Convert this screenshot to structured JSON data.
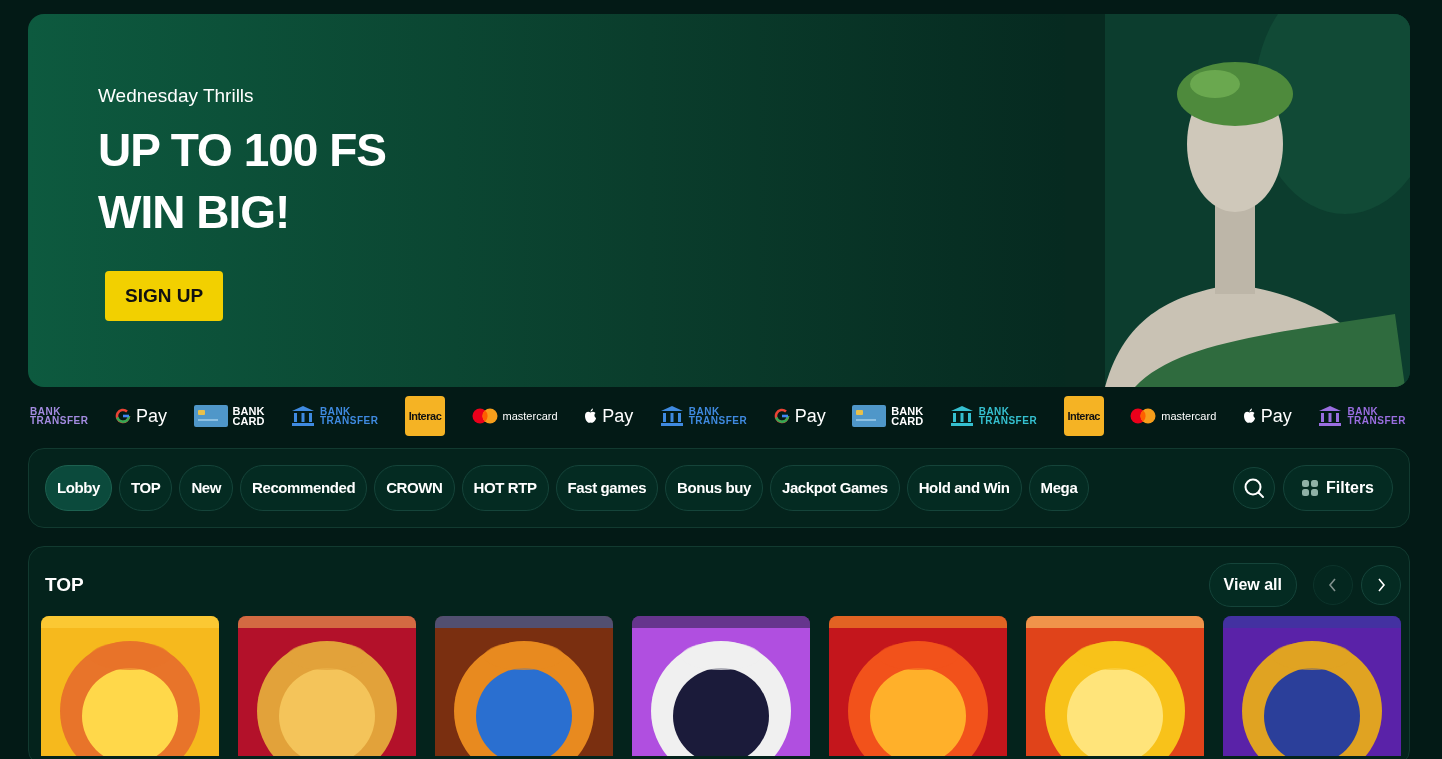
{
  "hero": {
    "kicker": "Wednesday Thrills",
    "headline": [
      "UP TO 100 FS",
      "WIN BIG!"
    ],
    "button": "SIGN UP"
  },
  "payments": [
    {
      "kind": "bank-transfer-text",
      "color": "#a38be0",
      "label": [
        "BANK",
        "TRANSFER"
      ]
    },
    {
      "kind": "gpay",
      "label": [
        "Pay"
      ]
    },
    {
      "kind": "bank-card",
      "label": [
        "BANK",
        "CARD"
      ]
    },
    {
      "kind": "bank-transfer",
      "color": "#3f8ae0",
      "label": [
        "BANK",
        "TRANSFER"
      ]
    },
    {
      "kind": "interac",
      "label": [
        "Interac"
      ]
    },
    {
      "kind": "mastercard",
      "label": [
        "mastercard"
      ]
    },
    {
      "kind": "applepay",
      "label": [
        "Pay"
      ]
    },
    {
      "kind": "bank-transfer",
      "color": "#3f8ae0",
      "label": [
        "BANK",
        "TRANSFER"
      ]
    },
    {
      "kind": "gpay",
      "label": [
        "Pay"
      ]
    },
    {
      "kind": "bank-card",
      "label": [
        "BANK",
        "CARD"
      ]
    },
    {
      "kind": "bank-transfer",
      "color": "#35c0d0",
      "label": [
        "BANK",
        "TRANSFER"
      ]
    },
    {
      "kind": "interac",
      "label": [
        "Interac"
      ]
    },
    {
      "kind": "mastercard",
      "label": [
        "mastercard"
      ]
    },
    {
      "kind": "applepay",
      "label": [
        "Pay"
      ]
    },
    {
      "kind": "bank-transfer",
      "color": "#9a6ee0",
      "label": [
        "BANK",
        "TRANSFER"
      ]
    }
  ],
  "categories": [
    {
      "label": "Lobby",
      "selected": true
    },
    {
      "label": "TOP",
      "selected": false
    },
    {
      "label": "New",
      "selected": false
    },
    {
      "label": "Recommended",
      "selected": false
    },
    {
      "label": "CROWN",
      "selected": false
    },
    {
      "label": "HOT RTP",
      "selected": false
    },
    {
      "label": "Fast games",
      "selected": false
    },
    {
      "label": "Bonus buy",
      "selected": false
    },
    {
      "label": "Jackpot Games",
      "selected": false
    },
    {
      "label": "Hold and Win",
      "selected": false
    },
    {
      "label": "Mega",
      "selected": false
    }
  ],
  "filters_button": "Filters",
  "section": {
    "title": "TOP",
    "view_all": "View all",
    "prev_disabled": true,
    "next_disabled": false
  }
}
